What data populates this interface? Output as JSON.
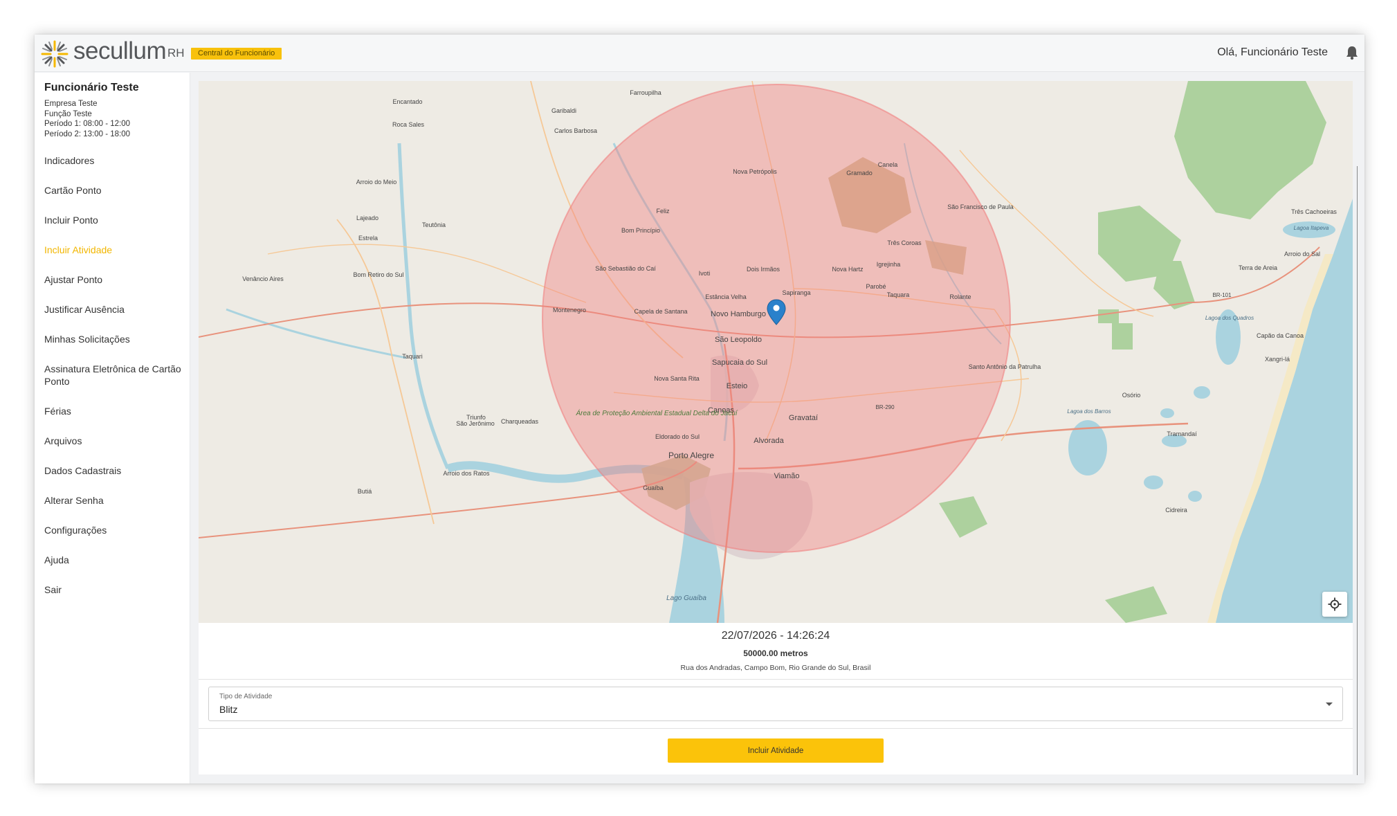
{
  "header": {
    "brand": "secullum",
    "brand_sub": "RH",
    "badge": "Central do Funcionário",
    "greeting": "Olá, Funcionário Teste"
  },
  "user": {
    "name": "Funcionário Teste",
    "company": "Empresa Teste",
    "role": "Função Teste",
    "period1": "Período 1: 08:00 - 12:00",
    "period2": "Período 2: 13:00 - 18:00"
  },
  "menu": [
    {
      "label": "Indicadores"
    },
    {
      "label": "Cartão Ponto"
    },
    {
      "label": "Incluir Ponto"
    },
    {
      "label": "Incluir Atividade",
      "active": true
    },
    {
      "label": "Ajustar Ponto"
    },
    {
      "label": "Justificar Ausência"
    },
    {
      "label": "Minhas Solicitações"
    },
    {
      "label": "Assinatura Eletrônica de Cartão Ponto"
    },
    {
      "label": "Férias"
    },
    {
      "label": "Arquivos"
    },
    {
      "label": "Dados Cadastrais"
    },
    {
      "label": "Alterar Senha"
    },
    {
      "label": "Configurações"
    },
    {
      "label": "Ajuda"
    },
    {
      "label": "Sair"
    }
  ],
  "map": {
    "cities": [
      "Farroupilha",
      "Encantado",
      "Garibaldi",
      "Carlos Barbosa",
      "Roca Sales",
      "Nova Petrópolis",
      "Canela",
      "Gramado",
      "Arroio do Meio",
      "Lajeado",
      "Estrela",
      "Teutônia",
      "Feliz",
      "São Francisco de Paula",
      "Três Cachoeiras",
      "Bom Princípio",
      "Três Coroas",
      "Lagoa Itapeva",
      "Arroio do Sal",
      "São Sebastião do Caí",
      "Ivoti",
      "Dois Irmãos",
      "Nova Hartz",
      "Igrejinha",
      "Terra de Areia",
      "Venâncio Aires",
      "Bom Retiro do Sul",
      "Sapiranga",
      "Parobé",
      "Taquara",
      "Estância Velha",
      "Rolante",
      "BR-101",
      "Montenegro",
      "Capela de Santana",
      "Novo Hamburgo",
      "Lagoa dos Quadros",
      "São Leopoldo",
      "Capão da Canoa",
      "Taquari",
      "Xangri-lá",
      "Sapucaia do Sul",
      "Santo Antônio da Patrulha",
      "Nova Santa Rita",
      "Esteio",
      "Osório",
      "BR-290",
      "Canoas",
      "Gravataí",
      "Lagoa dos Barros",
      "Triunfo",
      "São Jerônimo",
      "Charqueadas",
      "Área de Proteção Ambiental Estadual Delta do Jacuí",
      "Eldorado do Sul",
      "Alvorada",
      "Tramandaí",
      "Porto Alegre",
      "Arroio dos Ratos",
      "Viamão",
      "Butiá",
      "Guaíba",
      "Cidreira",
      "Lago Guaíba"
    ],
    "radius_color": "#f08080",
    "marker_color": "#2a81cb"
  },
  "activity": {
    "timestamp": "22/07/2026 - 14:26:24",
    "radius": "50000.00 metros",
    "address": "Rua dos Andradas, Campo Bom, Rio Grande do Sul, Brasil"
  },
  "form": {
    "type_label": "Tipo de Atividade",
    "type_value": "Blitz",
    "submit_label": "Incluir Atividade"
  },
  "icons": {
    "logo": "sun-burst-logo-icon",
    "notifications": "bell-icon",
    "locate": "crosshair-icon",
    "marker": "map-pin-icon"
  },
  "colors": {
    "accent": "#fbc30a",
    "active_menu": "#f2b600"
  }
}
